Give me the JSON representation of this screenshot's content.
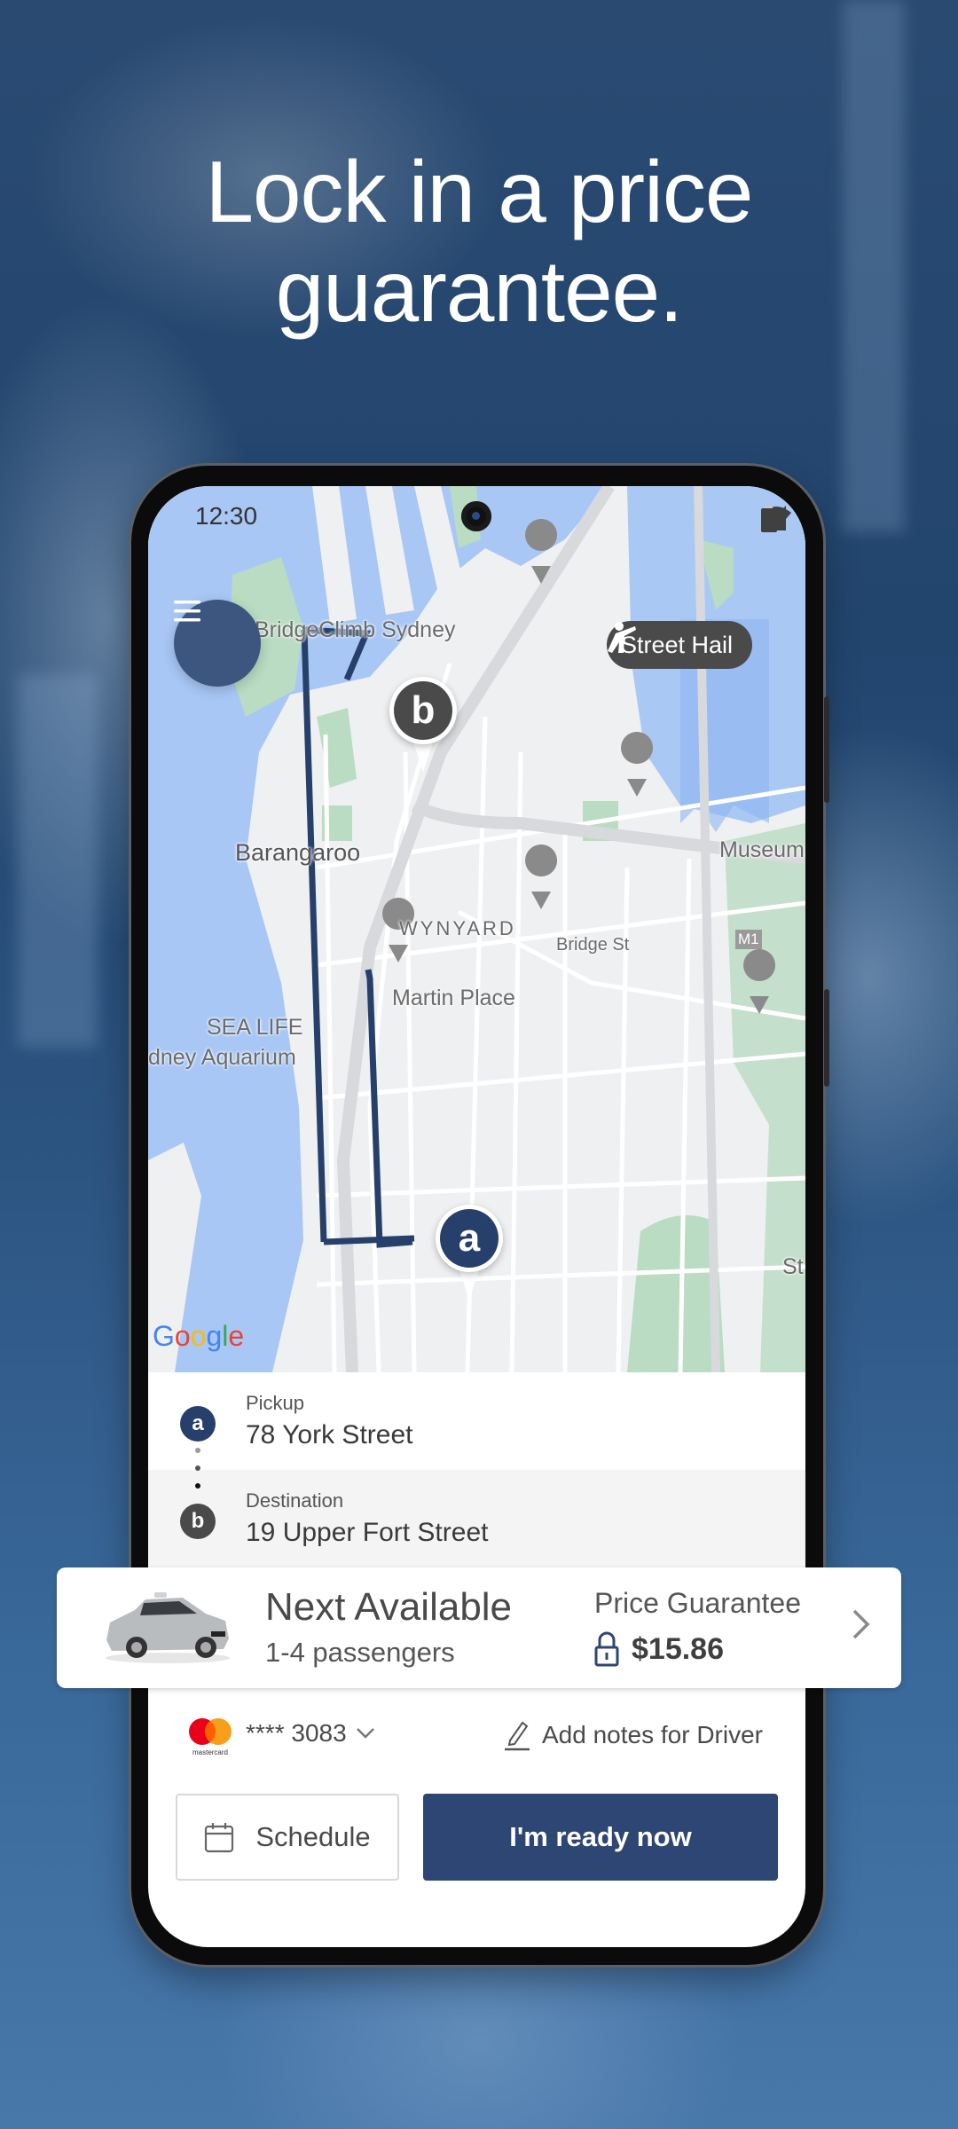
{
  "headline": {
    "line1": "Lock in a price",
    "line2": "guarantee."
  },
  "status_bar": {
    "time": "12:30",
    "icons": [
      "wifi-icon",
      "signal-icon",
      "battery-icon"
    ]
  },
  "map": {
    "menu_icon": "hamburger-menu-icon",
    "street_hail_label": "Street Hail",
    "labels": {
      "bridgeclimb": "BridgeClimb Sydney",
      "barangaroo": "Barangaroo",
      "wynyard": "WYNYARD",
      "bridge_st": "Bridge St",
      "museum": "Museum",
      "m1": "M1",
      "martin_place": "Martin Place",
      "sea_life_1": "SEA LIFE",
      "sea_life_2": "dney Aquarium",
      "st": "St"
    },
    "pin_pickup": "a",
    "pin_destination": "b",
    "attribution": "Google",
    "route_color": "#263f6b"
  },
  "trip": {
    "pickup": {
      "badge": "a",
      "label": "Pickup",
      "address": "78 York Street"
    },
    "destination": {
      "badge": "b",
      "label": "Destination",
      "address": "19 Upper Fort Street"
    }
  },
  "vehicle_option": {
    "title": "Next Available",
    "passengers": "1-4 passengers",
    "price_label": "Price Guarantee",
    "price": "$15.86"
  },
  "payment": {
    "card_brand": "mastercard",
    "card_masked": "**** 3083",
    "notes_label": "Add notes for Driver"
  },
  "actions": {
    "schedule_label": "Schedule",
    "ready_label": "I'm ready now"
  },
  "colors": {
    "primary": "#2e4673",
    "pickup_badge": "#263f6b",
    "destination_badge": "#4a4a4a",
    "street_hail_bg": "#4a4a4a",
    "menu_button": "#3c5680"
  }
}
